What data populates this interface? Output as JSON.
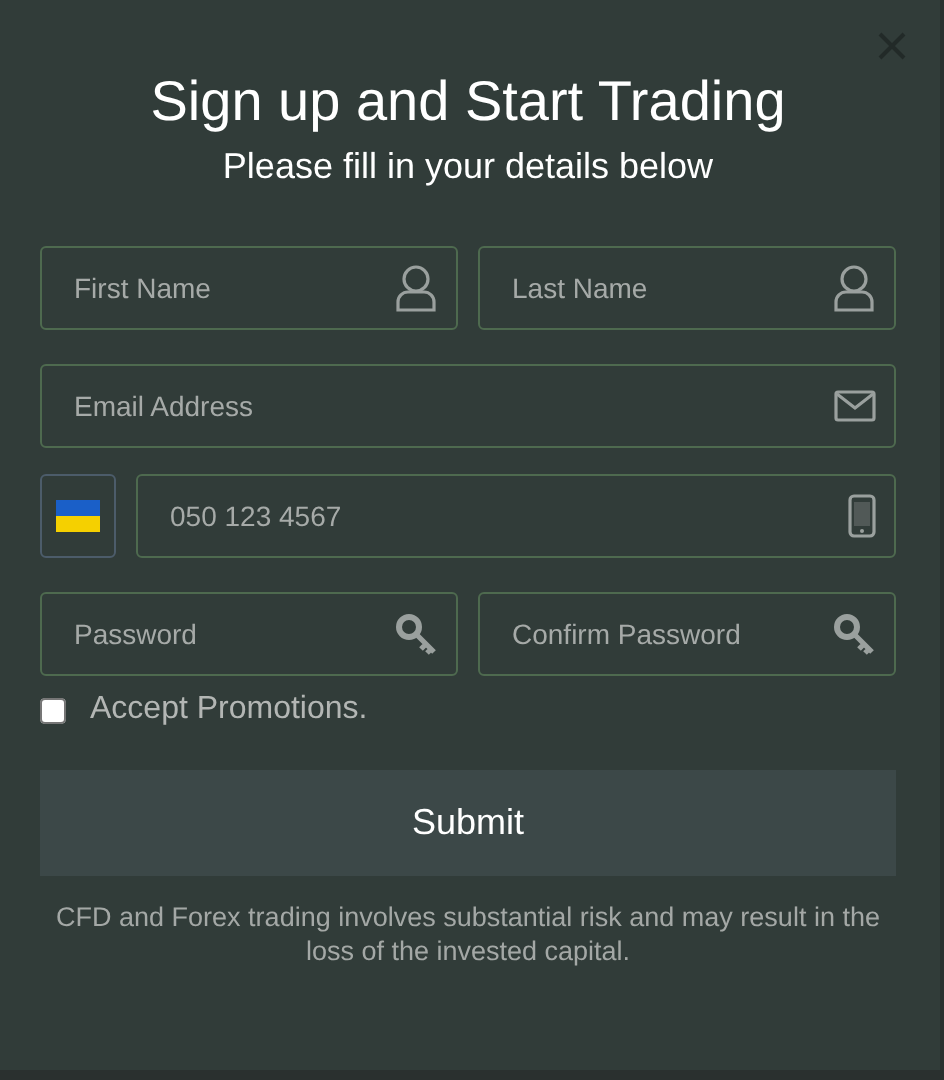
{
  "title": "Sign up and Start Trading",
  "subtitle": "Please fill in your details below",
  "rows": [
    {
      "kind": "pair",
      "fields": [
        {
          "placeholder": "First Name",
          "kind": "person"
        },
        {
          "placeholder": "Last Name",
          "kind": "person"
        }
      ]
    },
    {
      "kind": "single",
      "fields": [
        {
          "placeholder": "Email Address",
          "kind": "mail"
        }
      ]
    },
    {
      "kind": "phone",
      "fields": [
        {
          "placeholder": "050 123 4567",
          "kind": "phone"
        }
      ]
    },
    {
      "kind": "pair",
      "fields": [
        {
          "placeholder": "Password",
          "kind": "key"
        },
        {
          "placeholder": "Confirm Password",
          "kind": "key"
        }
      ]
    }
  ],
  "promotions": {
    "label": "Accept Promotions.",
    "checked": false
  },
  "submit": "Submit",
  "disclaimer": "CFD and Forex trading involves substantial risk and may result in the loss of the invested capital."
}
